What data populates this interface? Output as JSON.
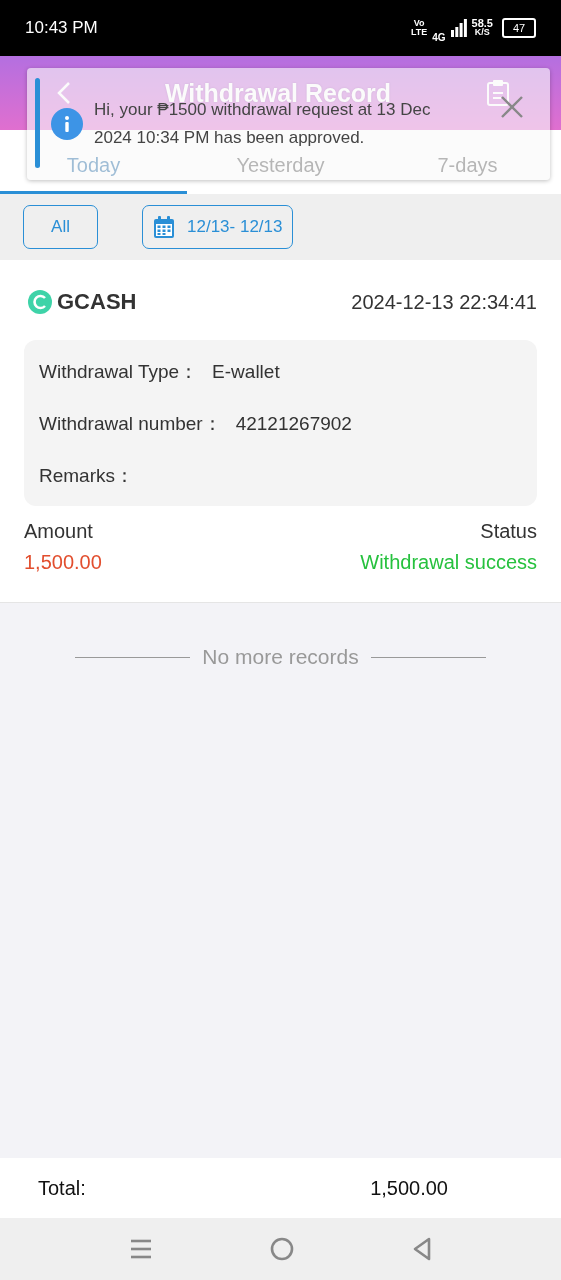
{
  "status_bar": {
    "time": "10:43 PM",
    "volte_top": "Vo",
    "volte_bottom": "LTE",
    "network": "4G",
    "speed_value": "58.5",
    "speed_unit": "K/S",
    "battery": "47"
  },
  "header": {
    "title": "Withdrawal Record"
  },
  "tabs": [
    {
      "label": "Today",
      "selected": true
    },
    {
      "label": "Yesterday",
      "selected": false
    },
    {
      "label": "7-days",
      "selected": false
    }
  ],
  "filters": {
    "all_button": "All",
    "date_range": "12/13- 12/13"
  },
  "records": [
    {
      "method": "GCASH",
      "datetime": "2024-12-13 22:34:41",
      "details": [
        {
          "label": "Withdrawal Type：",
          "value": "E-wallet"
        },
        {
          "label": "Withdrawal number：",
          "value": "42121267902"
        },
        {
          "label": "Remarks："
        }
      ],
      "amount_label": "Amount",
      "amount": "1,500.00",
      "status_label": "Status",
      "status": "Withdrawal success"
    }
  ],
  "end_message": "No more records",
  "footer": {
    "label": "Total:",
    "value": "1,500.00"
  },
  "notification": {
    "message": "Hi, your ₱1500 withdrawal request at 13 Dec 2024 10:34 PM has been approved."
  }
}
